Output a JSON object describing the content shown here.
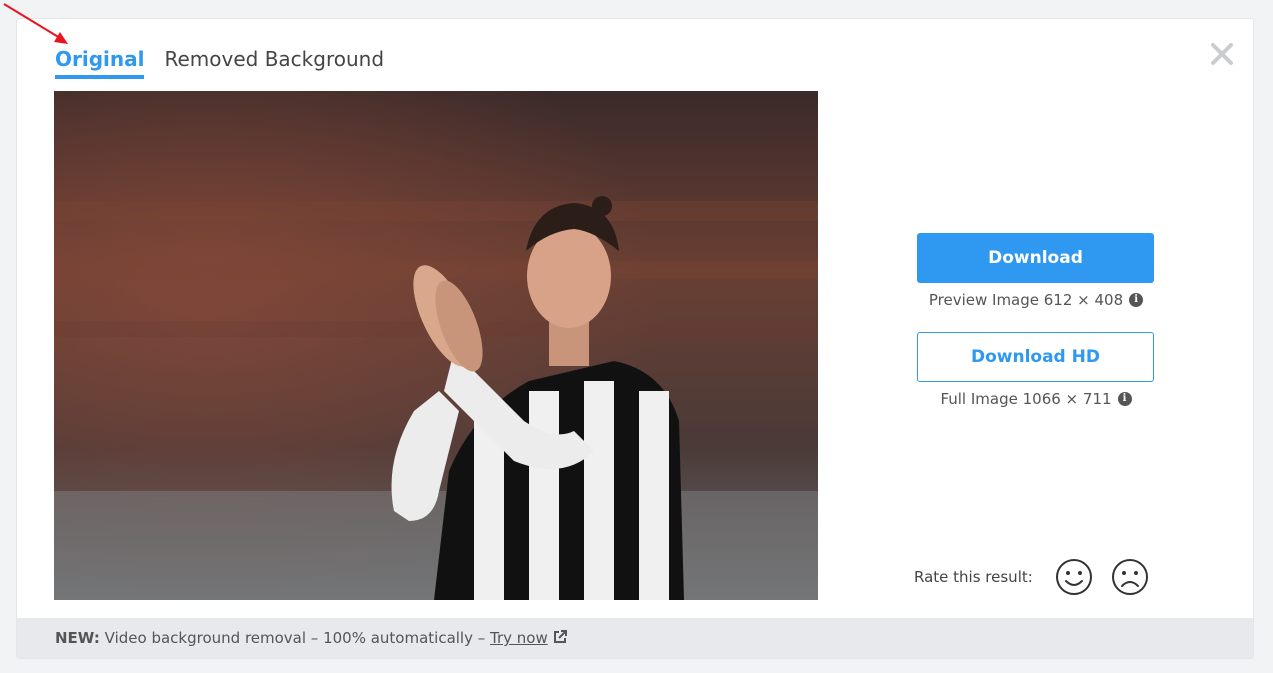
{
  "tabs": [
    {
      "label": "Original",
      "active": true
    },
    {
      "label": "Removed Background",
      "active": false
    }
  ],
  "close_icon": "close-icon",
  "photo": {
    "icon": "photo-of-soccer-player"
  },
  "download": {
    "label": "Download",
    "info": "Preview Image 612 × 408"
  },
  "download_hd": {
    "label": "Download HD",
    "info": "Full Image 1066 × 711"
  },
  "rating": {
    "label": "Rate this result:",
    "positive_icon": "smile-icon",
    "negative_icon": "frown-icon"
  },
  "footer": {
    "new_label": "NEW:",
    "text": " Video background removal – 100% automatically – ",
    "link": "Try now",
    "link_icon": "external-link-icon"
  },
  "colors": {
    "accent": "#2f98f0",
    "annotation_arrow": "#e8141e"
  }
}
